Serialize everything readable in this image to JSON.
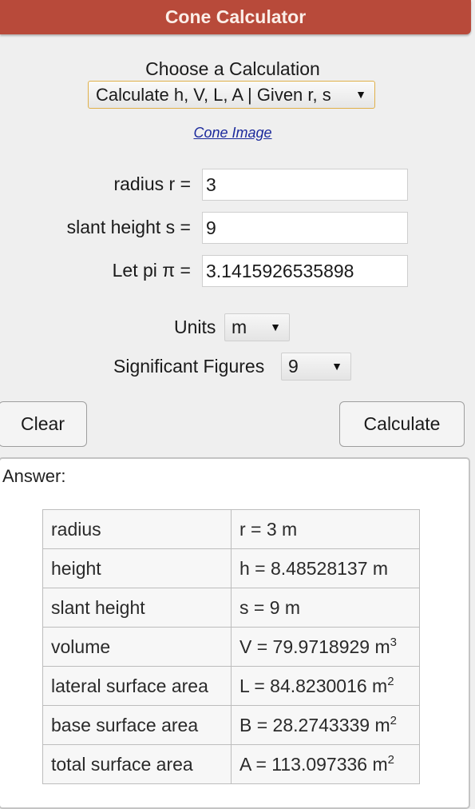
{
  "header": {
    "title": "Cone Calculator",
    "color": "#b84a3a"
  },
  "calculation": {
    "label": "Choose a Calculation",
    "selected": "Calculate h, V, L, A | Given r, s",
    "arrow_icon": "▼"
  },
  "cone_image_link": "Cone Image",
  "fields": [
    {
      "label": "radius r =",
      "value": "3"
    },
    {
      "label": "slant height s =",
      "value": "9"
    },
    {
      "label": "Let pi π =",
      "value": "3.1415926535898"
    }
  ],
  "units": {
    "label": "Units",
    "selected": "m"
  },
  "sig_figs": {
    "label": "Significant Figures",
    "selected": "9"
  },
  "buttons": {
    "clear": "Clear",
    "calculate": "Calculate"
  },
  "answer": {
    "label": "Answer:",
    "rows": [
      {
        "name": "radius",
        "value": "r = 3 m",
        "sup": ""
      },
      {
        "name": "height",
        "value": "h = 8.48528137 m",
        "sup": ""
      },
      {
        "name": "slant height",
        "value": "s = 9 m",
        "sup": ""
      },
      {
        "name": "volume",
        "value": "V = 79.9718929 m",
        "sup": "3"
      },
      {
        "name": "lateral surface area",
        "value": "L = 84.8230016 m",
        "sup": "2"
      },
      {
        "name": "base surface area",
        "value": "B = 28.2743339 m",
        "sup": "2"
      },
      {
        "name": "total surface area",
        "value": "A = 113.097336 m",
        "sup": "2"
      }
    ]
  }
}
